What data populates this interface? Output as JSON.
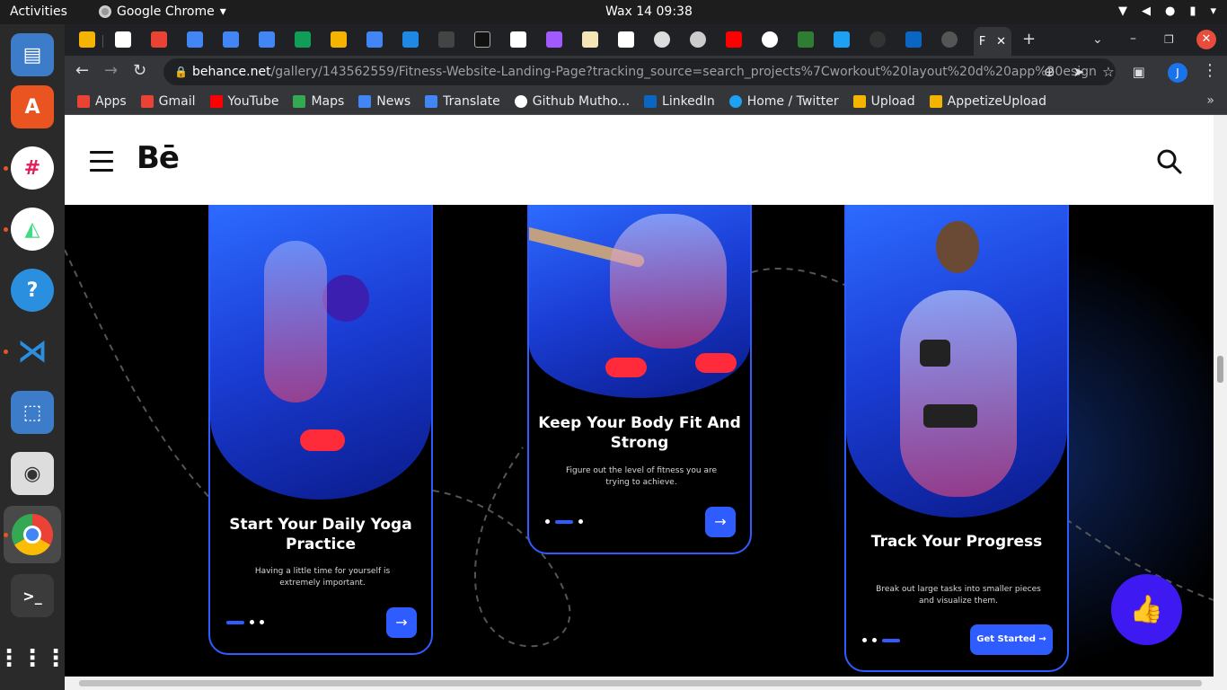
{
  "system": {
    "activities": "Activities",
    "app_name": "Google Chrome",
    "clock": "Wax 14  09:38"
  },
  "browser": {
    "active_tab_label": "F",
    "url_host": "behance.net",
    "url_path": "/gallery/143562559/Fitness-Website-Landing-Page?tracking_source=search_projects%7Cworkout%20layout%20d%20app%20esign",
    "profile_initial": "J"
  },
  "bookmarks": [
    {
      "label": "Apps",
      "color": "#ea4335"
    },
    {
      "label": "Gmail",
      "color": "#ea4335"
    },
    {
      "label": "YouTube",
      "color": "#ff0000"
    },
    {
      "label": "Maps",
      "color": "#34a853"
    },
    {
      "label": "News",
      "color": "#4285f4"
    },
    {
      "label": "Translate",
      "color": "#4285f4"
    },
    {
      "label": "Github Mutho...",
      "color": "#ffffff"
    },
    {
      "label": "LinkedIn",
      "color": "#0a66c2"
    },
    {
      "label": "Home / Twitter",
      "color": "#1da1f2"
    },
    {
      "label": "Upload",
      "color": "#f4b400"
    },
    {
      "label": "AppetizeUpload",
      "color": "#f4b400"
    }
  ],
  "behance": {
    "logo": "Bē"
  },
  "phones": [
    {
      "title": "Start Your Daily Yoga Practice",
      "subtitle": "Having a little time for yourself is extremely important.",
      "cta": "→"
    },
    {
      "title": "Keep Your Body Fit And Strong",
      "subtitle": "Figure out the level of fitness you are trying to achieve.",
      "cta": "→"
    },
    {
      "title": "Track Your Progress",
      "subtitle": "Break out large tasks into smaller pieces and visualize them.",
      "cta": "Get Started →"
    }
  ],
  "colors": {
    "accent": "#2f5cff",
    "like": "#3f19f2"
  }
}
